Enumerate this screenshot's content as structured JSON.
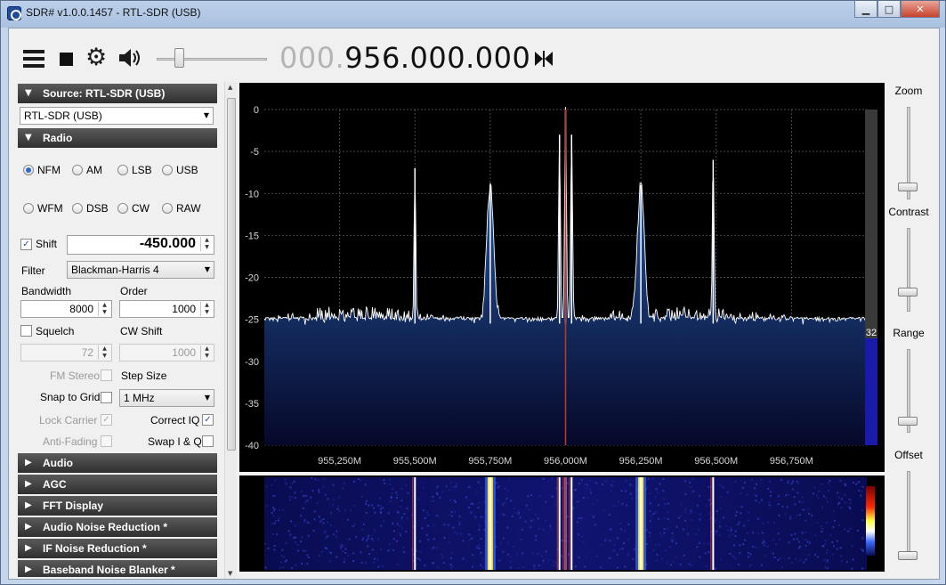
{
  "window": {
    "title": "SDR# v1.0.0.1457 - RTL-SDR (USB)"
  },
  "toolbar": {
    "frequency_dim": "000.",
    "frequency_main": "956.000.000"
  },
  "source_section": {
    "header": "Source: RTL-SDR (USB)",
    "device": "RTL-SDR (USB)"
  },
  "radio_section": {
    "header": "Radio",
    "modes": [
      {
        "label": "NFM",
        "selected": true
      },
      {
        "label": "AM",
        "selected": false
      },
      {
        "label": "LSB",
        "selected": false
      },
      {
        "label": "USB",
        "selected": false
      },
      {
        "label": "WFM",
        "selected": false
      },
      {
        "label": "DSB",
        "selected": false
      },
      {
        "label": "CW",
        "selected": false
      },
      {
        "label": "RAW",
        "selected": false
      }
    ],
    "shift_label": "Shift",
    "shift_value": "-450.000",
    "filter_label": "Filter",
    "filter_value": "Blackman-Harris 4",
    "bandwidth_label": "Bandwidth",
    "bandwidth_value": "8000",
    "order_label": "Order",
    "order_value": "1000",
    "squelch_label": "Squelch",
    "squelch_value": "72",
    "cwshift_label": "CW Shift",
    "cwshift_value": "1000",
    "fmstereo_label": "FM Stereo",
    "stepsize_label": "Step Size",
    "snap_label": "Snap to Grid",
    "step_value": "1 MHz",
    "lockcarrier_label": "Lock Carrier",
    "correctiq_label": "Correct IQ",
    "antifading_label": "Anti-Fading",
    "swapiq_label": "Swap I & Q"
  },
  "collapsed_sections": [
    "Audio",
    "AGC",
    "FFT Display",
    "Audio Noise Reduction *",
    "IF Noise Reduction *",
    "Baseband Noise Blanker *"
  ],
  "right_panel": {
    "zoom_label": "Zoom",
    "contrast_label": "Contrast",
    "range_label": "Range",
    "offset_label": "Offset",
    "zoom_level": 0.1,
    "contrast_level": 0.2,
    "range_level": 0.1,
    "offset_level": 0.0
  },
  "colors": {
    "spectrum_fill_top": "#2a68b8",
    "spectrum_fill_bottom": "#06082a",
    "center_line": "#c0392b",
    "level_bar": "#1a1aa8"
  },
  "chart_data": {
    "type": "area",
    "ylim": [
      -40,
      0
    ],
    "y_ticks": [
      "0",
      "-5",
      "-10",
      "-15",
      "-20",
      "-25",
      "-30",
      "-35",
      "-40"
    ],
    "x_ticks": [
      "955,250M",
      "955,500M",
      "955,750M",
      "956,000M",
      "956,250M",
      "956,500M",
      "956,750M"
    ],
    "xlim_mhz": [
      955.0,
      957.0
    ],
    "noise_floor_db": -25.5,
    "peaks": [
      {
        "freq_mhz": 955.5,
        "db": -7
      },
      {
        "freq_mhz": 955.75,
        "db": -9
      },
      {
        "freq_mhz": 955.98,
        "db": -3
      },
      {
        "freq_mhz": 956.0,
        "db": 0
      },
      {
        "freq_mhz": 956.02,
        "db": -3
      },
      {
        "freq_mhz": 956.25,
        "db": -9
      },
      {
        "freq_mhz": 956.49,
        "db": -6
      }
    ],
    "level_indicator": "32"
  }
}
